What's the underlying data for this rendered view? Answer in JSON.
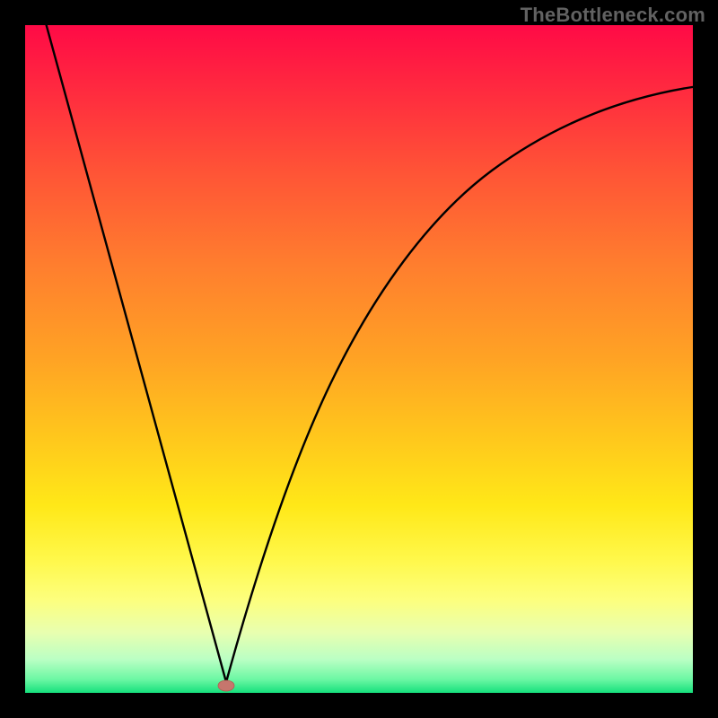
{
  "watermark": "TheBottleneck.com",
  "chart_data": {
    "type": "line",
    "title": "",
    "xlabel": "",
    "ylabel": "",
    "xlim": [
      0,
      100
    ],
    "ylim": [
      0,
      100
    ],
    "background_gradient": {
      "top_color": "#ff0a46",
      "bottom_color": "#15e07c",
      "meaning": "red high = bad / bottleneck, green low = good / balanced"
    },
    "series": [
      {
        "name": "bottleneck-curve",
        "x": [
          0,
          5,
          10,
          15,
          20,
          25,
          27,
          29,
          30,
          31,
          33,
          36,
          40,
          45,
          50,
          55,
          60,
          65,
          70,
          75,
          80,
          85,
          90,
          95,
          100
        ],
        "y": [
          100,
          84,
          67,
          51,
          34,
          17,
          10,
          3,
          0,
          3,
          10,
          20,
          32,
          44,
          53,
          60,
          66,
          71,
          75,
          78,
          81,
          83,
          85,
          86,
          87
        ]
      }
    ],
    "marker": {
      "x": 30,
      "y": 0,
      "shape": "ellipse",
      "color": "#c6766d"
    }
  }
}
